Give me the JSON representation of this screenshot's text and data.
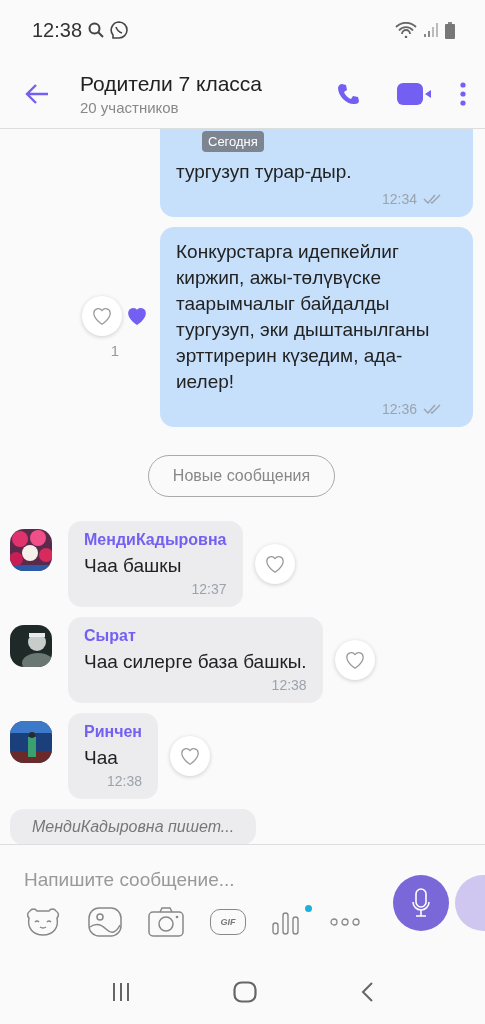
{
  "status_bar": {
    "time": "12:38"
  },
  "header": {
    "title": "Родители 7 класса",
    "subtitle": "20 участников"
  },
  "date_chip": "Сегодня",
  "messages": [
    {
      "kind": "outgoing",
      "text": "тургузуп турар-дыр.",
      "time": "12:34",
      "read": true
    },
    {
      "kind": "outgoing",
      "text": "Конкурстарга идепкейлиг киржип, ажы-төлүвүске таарымчалыг байдалды тургузуп, эки дыштанылганы эрттирерин күзедим, ада-иелер!",
      "time": "12:36",
      "read": true,
      "liked": false,
      "reaction_count": "1"
    },
    {
      "kind": "divider",
      "text": "Новые сообщения"
    },
    {
      "kind": "incoming",
      "sender": "МендиКадыровна",
      "text": "Чаа башкы",
      "time": "12:37",
      "liked": false
    },
    {
      "kind": "incoming",
      "sender": "Сырат",
      "text": "Чаа силерге база башкы.",
      "time": "12:38",
      "liked": false
    },
    {
      "kind": "incoming",
      "sender": "Ринчен",
      "text": "Чаа",
      "time": "12:38",
      "liked": false
    }
  ],
  "typing": "МендиКадыровна пишет...",
  "composer": {
    "placeholder": "Напишите сообщение...",
    "gif_label": "GIF",
    "new_dot": true
  }
}
